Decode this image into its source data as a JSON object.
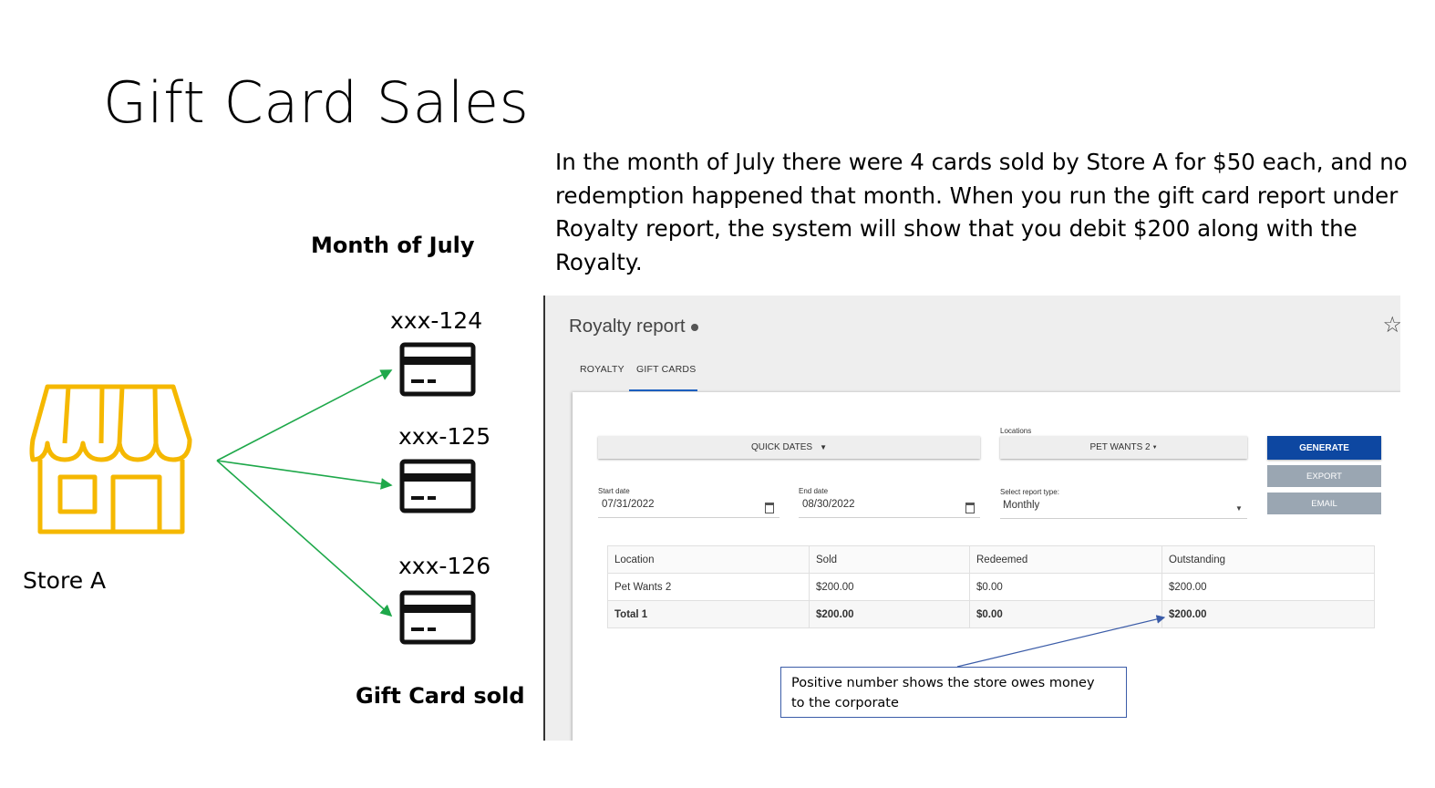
{
  "slide": {
    "title": "Gift Card Sales",
    "description": "In the month of July there were 4 cards sold by Store A for $50 each, and no redemption happened that month. When you run the gift card report under Royalty report, the system will show that you debit $200 along with the Royalty.",
    "month_label": "Month of July",
    "store_label": "Store A",
    "sold_label": "Gift Card sold",
    "cards": [
      "xxx-124",
      "xxx-125",
      "xxx-126"
    ],
    "colors": {
      "store_icon": "#f5b800",
      "arrows": "#1ea84a",
      "callout_border": "#3b5ca8"
    }
  },
  "report": {
    "title": "Royalty report",
    "tabs": [
      {
        "label": "ROYALTY",
        "active": false
      },
      {
        "label": "GIFT CARDS",
        "active": true
      }
    ],
    "quick_dates_label": "QUICK DATES",
    "locations_label": "Locations",
    "location_value": "PET WANTS 2",
    "start_date_label": "Start date",
    "start_date": "07/31/2022",
    "end_date_label": "End date",
    "end_date": "08/30/2022",
    "report_type_label": "Select report type:",
    "report_type": "Monthly",
    "buttons": {
      "generate": "GENERATE",
      "export": "EXPORT",
      "email": "EMAIL"
    },
    "colors": {
      "generate": "#0d47a1",
      "tab_underline": "#1e63c4"
    },
    "table": {
      "headers": [
        "Location",
        "Sold",
        "Redeemed",
        "Outstanding"
      ],
      "rows": [
        [
          "Pet Wants 2",
          "$200.00",
          "$0.00",
          "$200.00"
        ],
        [
          "Total 1",
          "$200.00",
          "$0.00",
          "$200.00"
        ]
      ]
    }
  },
  "callout": {
    "line1": "Positive number shows the store owes money",
    "line2": "to the corporate"
  }
}
